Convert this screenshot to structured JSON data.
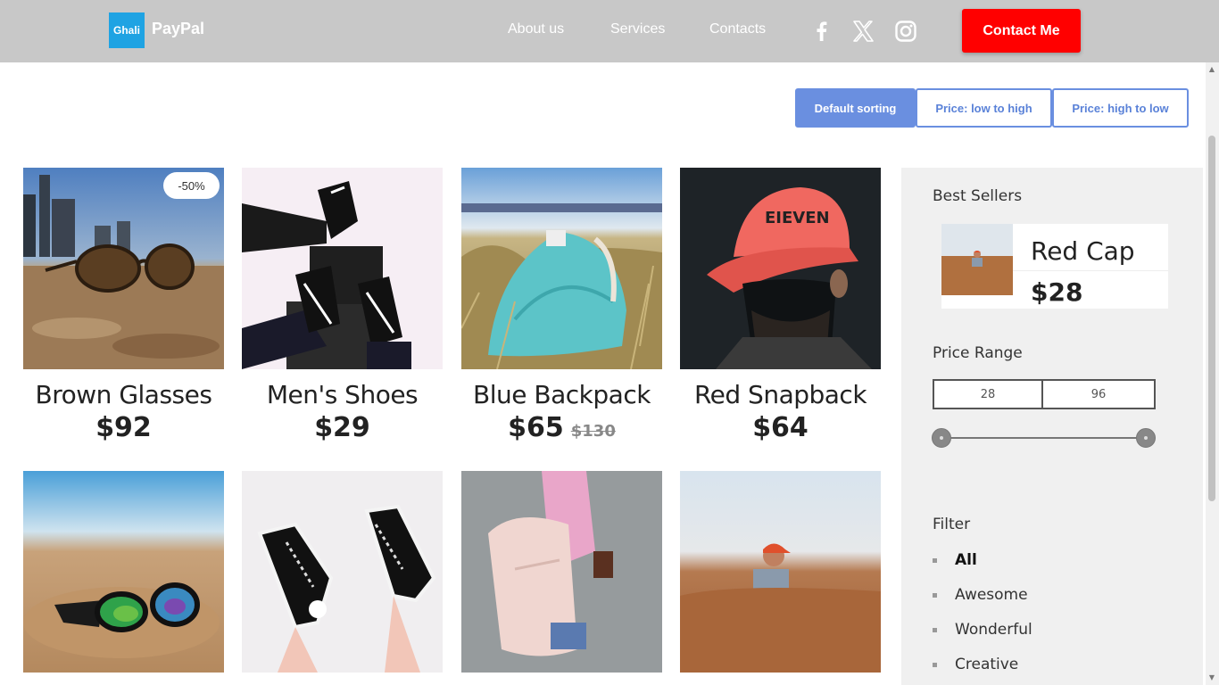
{
  "header": {
    "logo_badge": "Ghali",
    "logo_text": "PayPal",
    "nav": [
      "About us",
      "Services",
      "Contacts"
    ],
    "social_icons": [
      "facebook-icon",
      "x-icon",
      "instagram-icon"
    ],
    "contact_button": "Contact Me"
  },
  "sorting": {
    "options": [
      "Default sorting",
      "Price: low to high",
      "Price: high to low"
    ],
    "active": "Default sorting"
  },
  "products": [
    {
      "name": "Brown Glasses",
      "price": "$92",
      "badge": "-50%"
    },
    {
      "name": "Men's Shoes",
      "price": "$29"
    },
    {
      "name": "Blue Backpack",
      "price": "$65",
      "old_price": "$130"
    },
    {
      "name": "Red Snapback",
      "price": "$64"
    }
  ],
  "sidebar": {
    "best_sellers": {
      "heading": "Best Sellers",
      "name": "Red Cap",
      "price": "$28"
    },
    "price_range": {
      "heading": "Price Range",
      "min": "28",
      "max": "96"
    },
    "filter": {
      "heading": "Filter",
      "items": [
        "All",
        "Awesome",
        "Wonderful",
        "Creative"
      ],
      "active": "All"
    }
  },
  "colors": {
    "header_bg": "#c8c8c8",
    "accent_red": "#ff0000",
    "accent_blue": "#6a8fe0",
    "sidebar_bg": "#f0f0f0"
  }
}
